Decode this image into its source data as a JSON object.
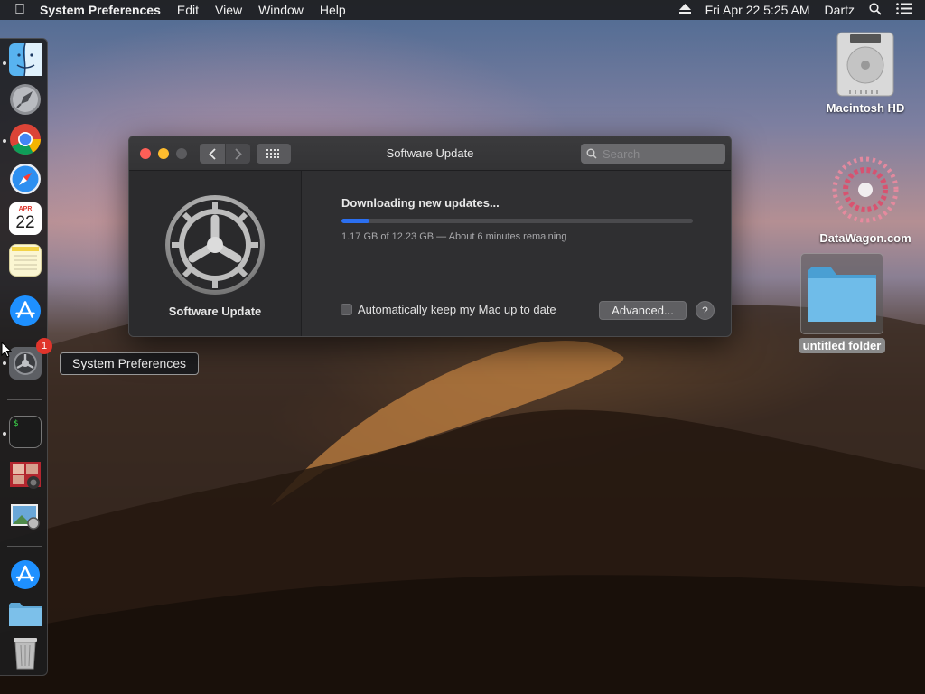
{
  "menubar": {
    "apple_icon": "apple-icon",
    "app_name": "System Preferences",
    "menus": [
      "Edit",
      "View",
      "Window",
      "Help"
    ],
    "clock": "Fri Apr 22  5:25 AM",
    "user": "Dartz"
  },
  "window": {
    "title": "Software Update",
    "search_placeholder": "Search",
    "pane_label": "Software Update",
    "status_title": "Downloading new updates...",
    "progress_fraction": 0.08,
    "progress_detail": "1.17 GB of 12.23 GB — About 6 minutes remaining",
    "auto_update_label": "Automatically keep my Mac up to date",
    "auto_update_checked": false,
    "advanced_label": "Advanced...",
    "help_label": "?",
    "traffic_colors": [
      "#fe5f57",
      "#febc2e",
      "#5b5b5e"
    ]
  },
  "dock": {
    "tooltip": "System Preferences",
    "badge_count": "1",
    "calendar_month": "APR",
    "calendar_day": "22"
  },
  "desktop": {
    "items": [
      {
        "label": "Macintosh HD"
      },
      {
        "label": "DataWagon.com"
      },
      {
        "label": "untitled folder"
      }
    ]
  },
  "colors": {
    "accent": "#2b6ff0",
    "badge": "#e0342b"
  }
}
